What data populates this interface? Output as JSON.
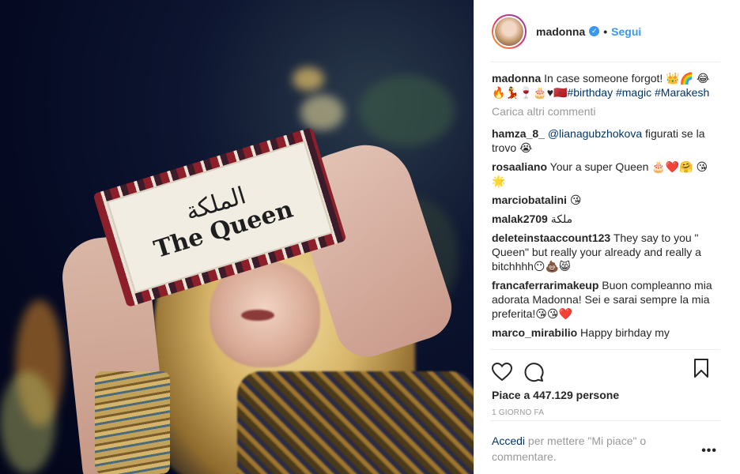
{
  "post": {
    "username": "madonna",
    "follow_label": "Segui",
    "dot": "•",
    "verified_mark": "✓",
    "photo_sign_arabic": "الملكة",
    "photo_sign_text": "The Queen"
  },
  "caption": {
    "username": "madonna",
    "text": "In case someone forgot! 👑🌈 😂🔥💃🍷🎂♥🇲🇦",
    "hashtags": [
      "#birthday",
      "#magic",
      "#Marakesh"
    ]
  },
  "load_more_label": "Carica altri commenti",
  "comments": [
    {
      "user": "hamza_8_",
      "mention": "@lianagubzhokova",
      "text": "figurati se la trovo 😭"
    },
    {
      "user": "rosaaliano",
      "mention": "",
      "text": "Your a super Queen 🎂❤️🤗 😘🌟"
    },
    {
      "user": "marciobatalini",
      "mention": "",
      "text": "😘"
    },
    {
      "user": "malak2709",
      "mention": "",
      "text": "ملكة"
    },
    {
      "user": "deleteinstaaccount123",
      "mention": "",
      "text": "They say to you \" Queen\" but really your already and really a bitchhhh😶💩😸"
    },
    {
      "user": "francaferrarimakeup",
      "mention": "",
      "text": "Buon compleanno mia adorata Madonna! Sei e sarai sempre la mia preferita!😘😘❤️"
    },
    {
      "user": "marco_mirabilio",
      "mention": "",
      "text": "Happy birhday my"
    }
  ],
  "likes": "Piace a 447.129 persone",
  "time_ago": "1 GIORNO FA",
  "footer": {
    "login_link": "Accedi",
    "login_text": "per mettere \"Mi piace\" o commentare.",
    "more_label": "•••"
  },
  "icons": {
    "like": "heart-icon",
    "comment": "comment-icon",
    "save": "bookmark-icon",
    "options": "more-options-icon"
  },
  "colors": {
    "link_blue": "#3897f0",
    "hashtag_blue": "#003569",
    "muted_gray": "#999999"
  }
}
